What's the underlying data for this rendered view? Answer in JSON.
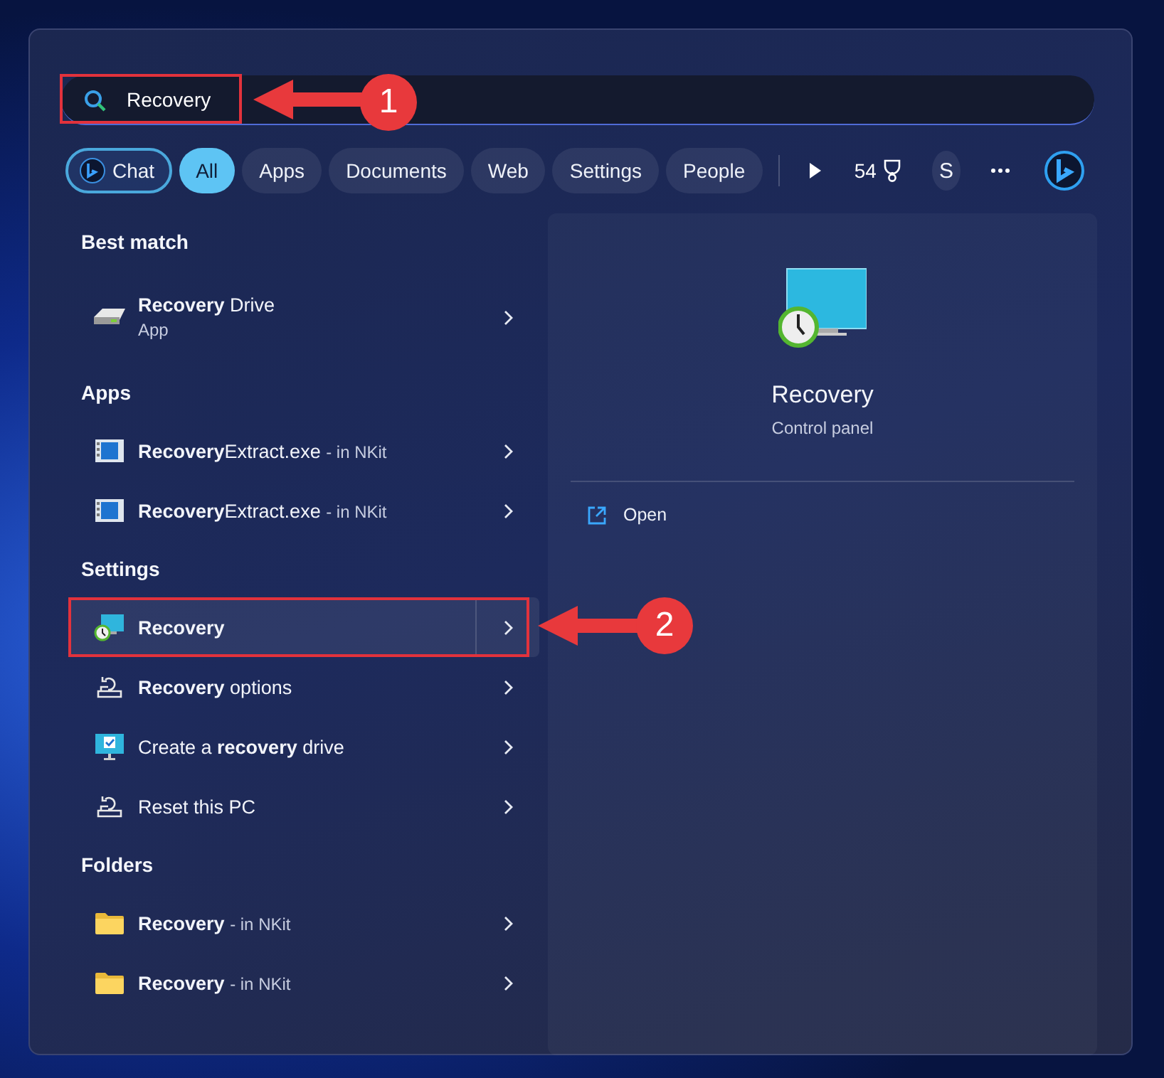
{
  "search": {
    "value": "Recovery"
  },
  "chat": {
    "label": "Chat"
  },
  "filters": [
    {
      "label": "All",
      "selected": true
    },
    {
      "label": "Apps",
      "selected": false
    },
    {
      "label": "Documents",
      "selected": false
    },
    {
      "label": "Web",
      "selected": false
    },
    {
      "label": "Settings",
      "selected": false
    },
    {
      "label": "People",
      "selected": false
    }
  ],
  "points": "54",
  "avatar": "S",
  "sections": [
    {
      "heading": "Best match",
      "items": [
        {
          "kind": "drive",
          "title": "**Recovery** Drive",
          "subtitle": "App",
          "selected": false
        }
      ]
    },
    {
      "heading": "Apps",
      "items": [
        {
          "kind": "exe",
          "title": "**Recovery**Extract.exe",
          "suffix": "- in NKit",
          "selected": false
        },
        {
          "kind": "exe",
          "title": "**Recovery**Extract.exe",
          "suffix": "- in NKit",
          "selected": false
        }
      ]
    },
    {
      "heading": "Settings",
      "items": [
        {
          "kind": "monitor-clock",
          "title": "**Recovery**",
          "selected": true
        },
        {
          "kind": "reset",
          "title": "**Recovery** options",
          "selected": false
        },
        {
          "kind": "monitor-check",
          "title": "Create a **recovery** drive",
          "selected": false
        },
        {
          "kind": "reset",
          "title": "Reset this PC",
          "selected": false
        }
      ]
    },
    {
      "heading": "Folders",
      "items": [
        {
          "kind": "folder",
          "title": "**Recovery**",
          "suffix": "- in NKit",
          "selected": false
        },
        {
          "kind": "folder",
          "title": "**Recovery**",
          "suffix": "- in NKit",
          "selected": false
        }
      ]
    }
  ],
  "preview": {
    "title": "Recovery",
    "subtitle": "Control panel",
    "actions": [
      {
        "label": "Open"
      }
    ]
  },
  "annotations": [
    {
      "number": "1"
    },
    {
      "number": "2"
    }
  ]
}
